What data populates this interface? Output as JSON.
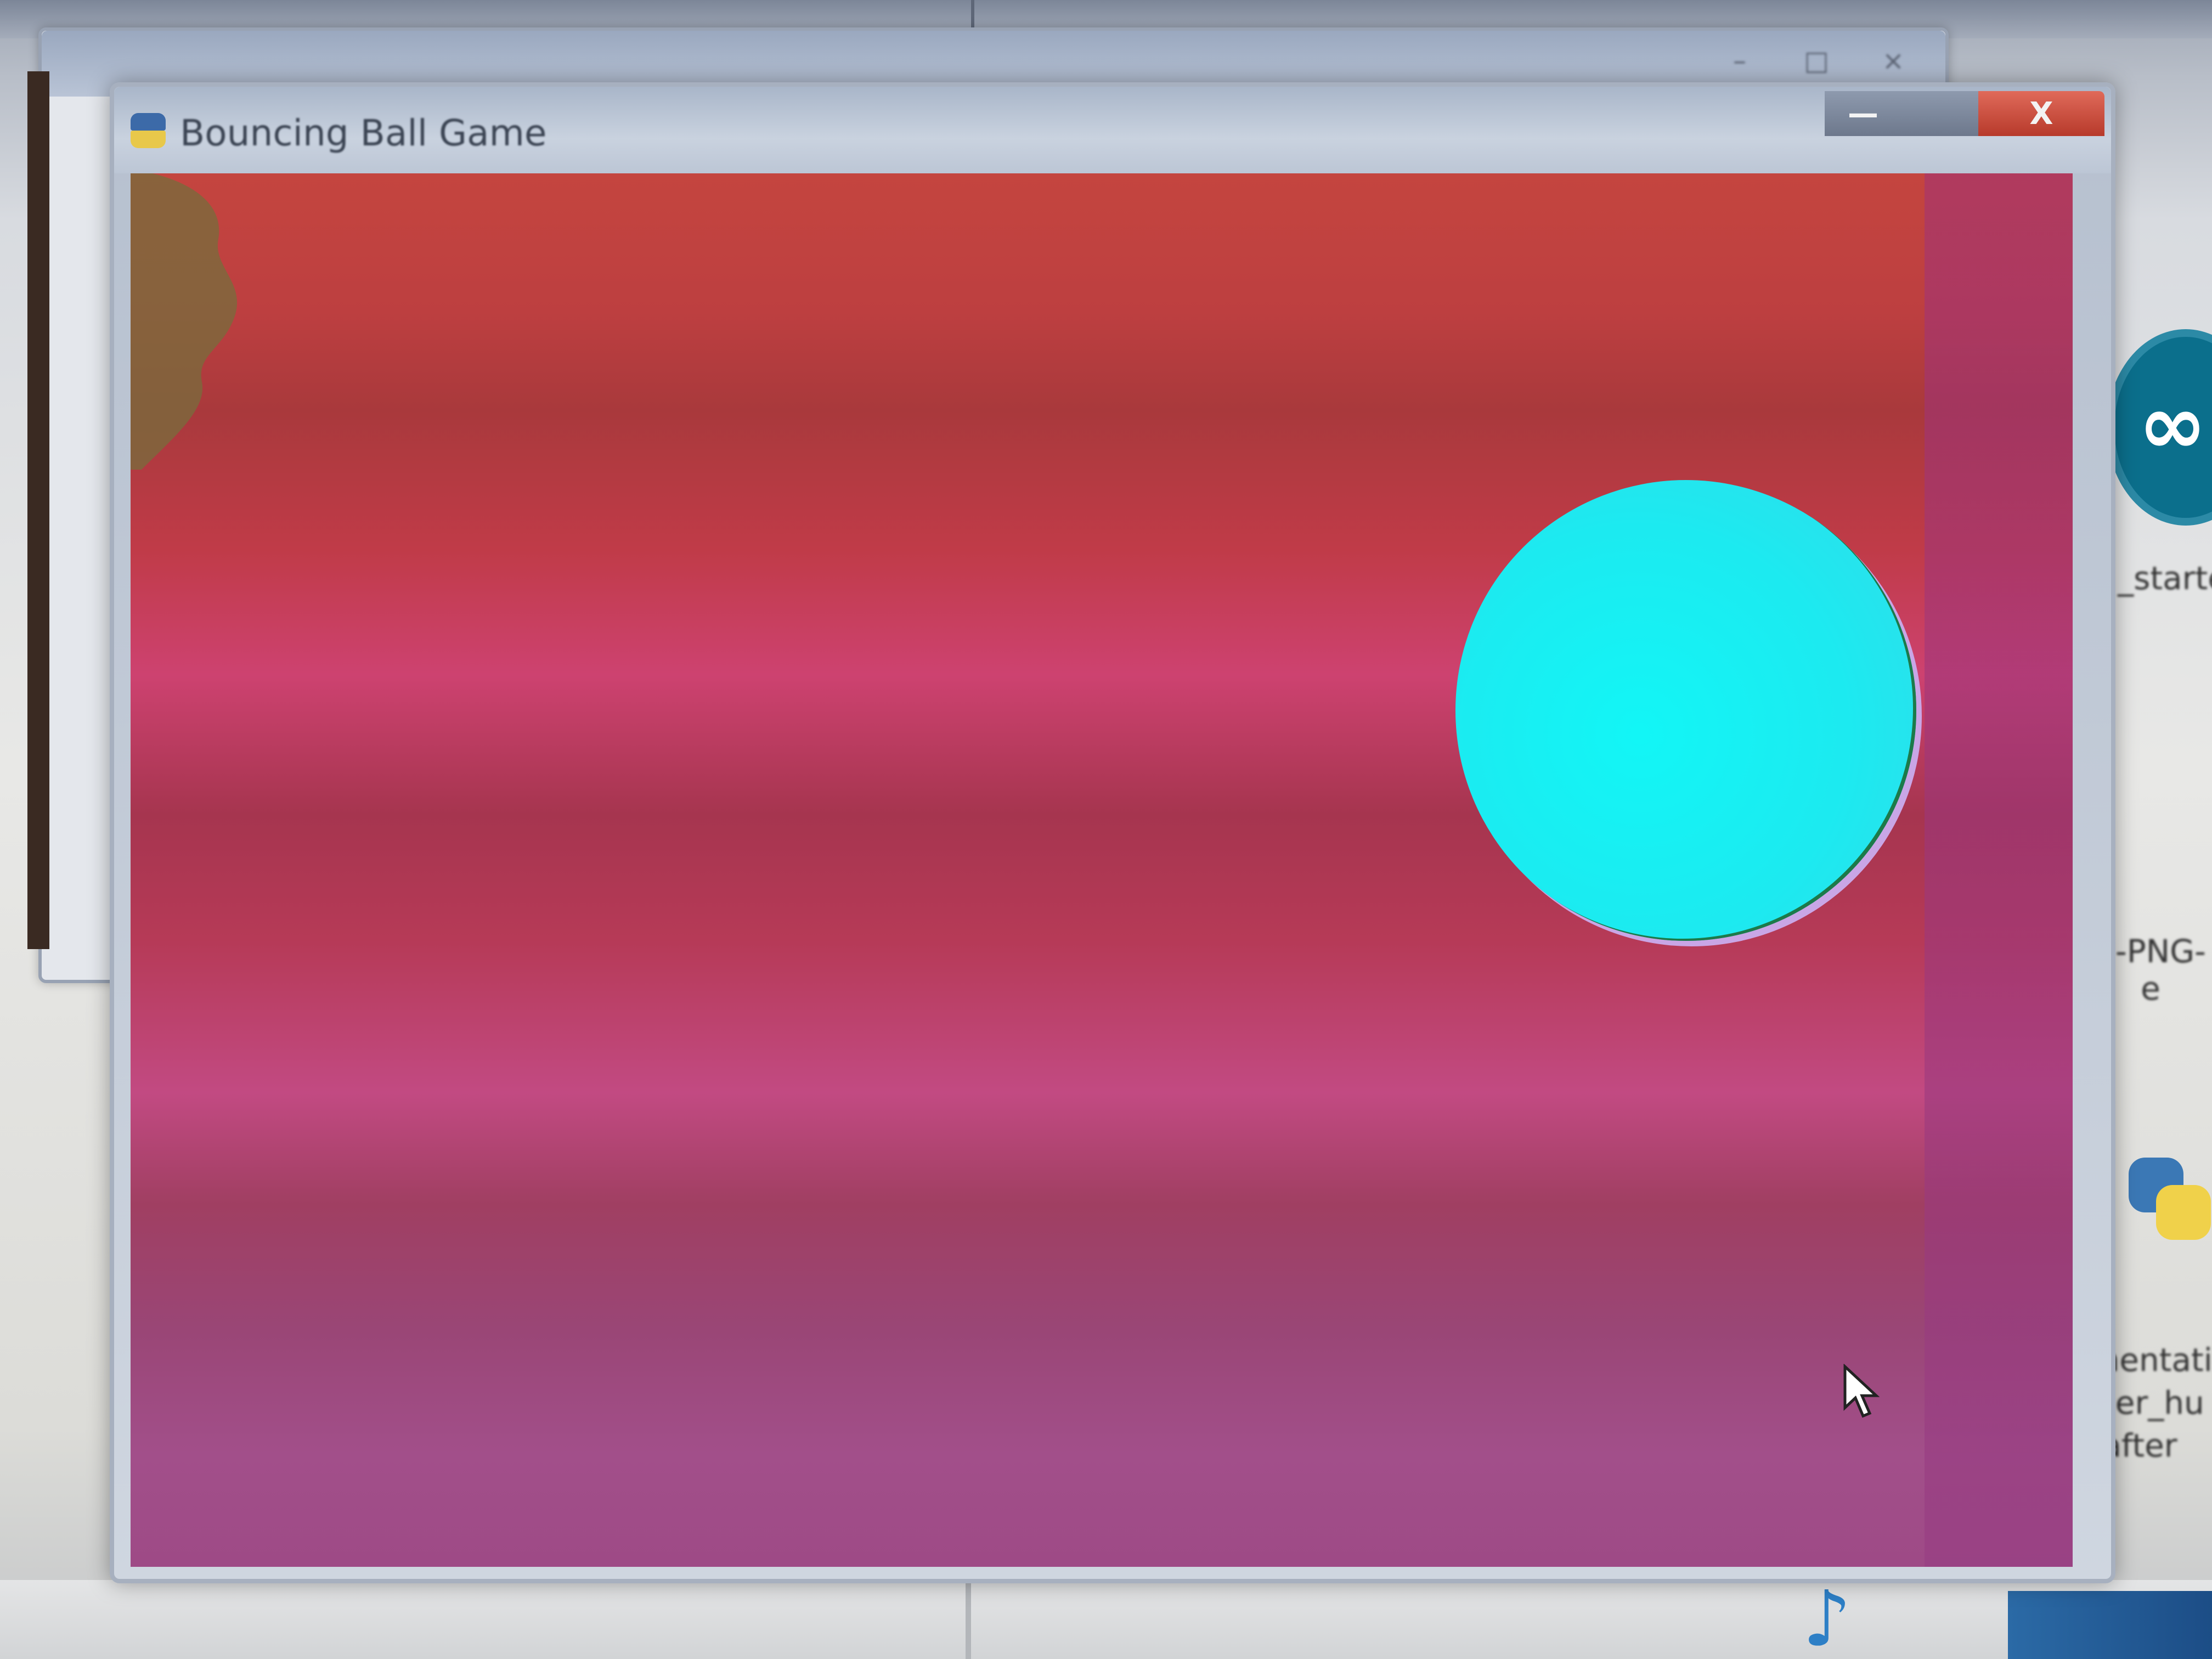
{
  "background_window": {
    "caption_minimize": "–",
    "caption_maximize": "□",
    "caption_close": "×"
  },
  "desktop_icons": [
    {
      "label": "_starte"
    },
    {
      "label": "d-PNG-\ne"
    },
    {
      "label": "umentatio\nnger_hu\nafter"
    }
  ],
  "game_window": {
    "title": "Bouncing Ball Game",
    "caption_minimize": "—",
    "caption_maximize": "",
    "caption_close": "X"
  },
  "game": {
    "background_colors": [
      "#c4453f",
      "#cd4270",
      "#a6354f",
      "#c24a82",
      "#9e4a86"
    ],
    "ball_color": "#12f6f6",
    "ball_outline_color": "#1c7a4a"
  }
}
